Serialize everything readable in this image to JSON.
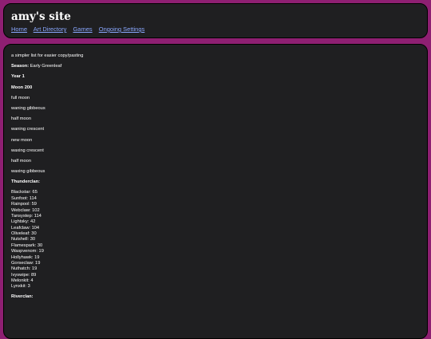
{
  "site": {
    "title": "amy's site"
  },
  "nav": [
    {
      "label": "Home"
    },
    {
      "label": "Art Directory"
    },
    {
      "label": "Games"
    },
    {
      "label": "Ongoing Settings"
    }
  ],
  "content": {
    "intro": "a simpler list for easier copy/pasting",
    "season_label": "Season:",
    "season_value": "Early Greenleaf",
    "year": "Year 1",
    "moon": "Moon 200",
    "phases": [
      "full moon",
      "waning gibbeous",
      "half moon",
      "waning crescent",
      "new moon",
      "waxing crescent",
      "half moon",
      "waxing gibbeous"
    ],
    "thunderclan_heading": "Thunderclan:",
    "thunderclan": [
      "Blackstar: 65",
      "Sunfoot: 114",
      "Rainpool: 59",
      "Webclaw: 102",
      "Tansystep: 114",
      "Lightsky: 42",
      "Leafclaw: 104",
      "Oliveleaf: 30",
      "Nutshell: 30",
      "Flamespark: 30",
      "Waspvenom: 19",
      "Hollyhawk: 19",
      "Gorseclaw: 19",
      "Nuthatch: 19",
      "Ivyswipe: 89",
      "Melonkit: 4",
      "Lynxkit: 3"
    ],
    "riverclan_heading": "Riverclan:"
  }
}
